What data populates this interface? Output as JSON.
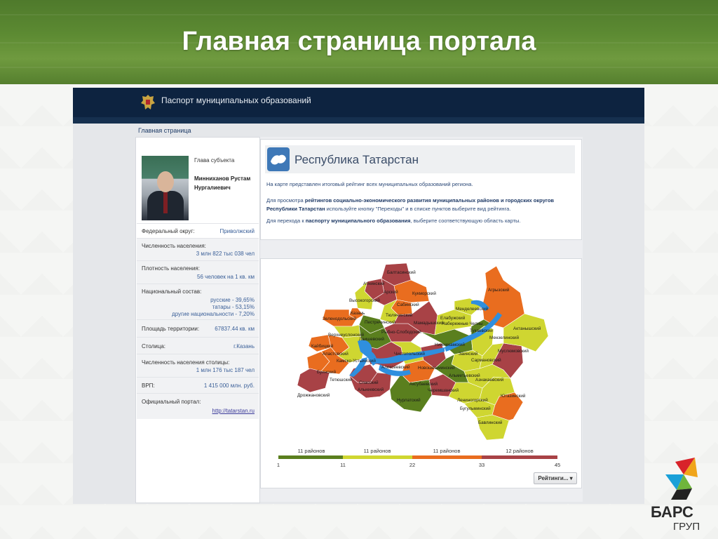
{
  "slide": {
    "title": "Главная страница портала"
  },
  "portal": {
    "name": "Паспорт муниципальных образований",
    "breadcrumb": "Главная страница"
  },
  "profile": {
    "head_label": "Глава субъекта",
    "head_name": "Минниханов Рустам Нургалиевич",
    "fields": {
      "district_label": "Федеральный округ:",
      "district_value": "Приволжский",
      "population_label": "Численность населения:",
      "population_value": "3 млн 822 тыс 038 чел",
      "density_label": "Плотность населения:",
      "density_value": "56 человек на 1 кв. км",
      "ethnic_label": "Национальный состав:",
      "ethnic_values": [
        "русские - 39,65%",
        "татары - 53,15%",
        "другие национальности - 7,20%"
      ],
      "area_label": "Площадь территории:",
      "area_value": "67837.44 кв. км",
      "capital_label": "Столица:",
      "capital_value": "г.Казань",
      "capital_pop_label": "Численность населения столицы:",
      "capital_pop_value": "1 млн 176 тыс 187 чел",
      "grp_label": "ВРП:",
      "grp_value": "1 415 000 млн. руб.",
      "portal_label": "Официальный портал:",
      "portal_value": "http://tatarstan.ru"
    }
  },
  "region": {
    "title": "Республика Татарстан",
    "p1": "На карте представлен итоговый рейтинг всех муниципальных образований региона.",
    "p2_a": "Для просмотра ",
    "p2_b": "рейтингов социально-экономического развития муниципальных районов и городских округов Республики Татарстан",
    "p2_c": " используйте кнопку \"Переходы\" и в списке пунктов выберите вид рейтинга.",
    "p3_a": "Для перехода к ",
    "p3_b": "паспорту муниципального образования",
    "p3_c": ", выберите соответствующую область карты."
  },
  "legend": {
    "groups": [
      "11 районов",
      "11 районов",
      "11 районов",
      "12 районов"
    ],
    "ticks": [
      "1",
      "11",
      "22",
      "33",
      "45"
    ],
    "colors": [
      "#5a7f1e",
      "#cfd631",
      "#e96d1f",
      "#a84246"
    ]
  },
  "ratings_button": "Рейтинги... ▾",
  "logo": {
    "line1": "БАРС",
    "line2": "ГРУП"
  },
  "districts": [
    {
      "name": "Балтасинский",
      "color": "#a84246"
    },
    {
      "name": "Атнинский",
      "color": "#a84246"
    },
    {
      "name": "Арский",
      "color": "#a84246"
    },
    {
      "name": "Кукморский",
      "color": "#e96d1f"
    },
    {
      "name": "Сабинский",
      "color": "#e96d1f"
    },
    {
      "name": "Высокогорский",
      "color": "#cfd631"
    },
    {
      "name": "Казань",
      "color": "#e96d1f"
    },
    {
      "name": "Тюлячинский",
      "color": "#cfd631"
    },
    {
      "name": "Зеленодольский",
      "color": "#e96d1f"
    },
    {
      "name": "Пестречинский",
      "color": "#5a7f1e"
    },
    {
      "name": "Рыбно-Слободский",
      "color": "#a84246"
    },
    {
      "name": "Мамадышский",
      "color": "#a84246"
    },
    {
      "name": "Верхнеуслонский",
      "color": "#cfd631"
    },
    {
      "name": "Лаишевский",
      "color": "#5a7f1e"
    },
    {
      "name": "Кайбицкий",
      "color": "#e96d1f"
    },
    {
      "name": "Апастовский",
      "color": "#e96d1f"
    },
    {
      "name": "Камско-Устьинский",
      "color": "#cfd631"
    },
    {
      "name": "Буинский",
      "color": "#e96d1f"
    },
    {
      "name": "Тетюшский",
      "color": "#e96d1f"
    },
    {
      "name": "Дрожжановский",
      "color": "#a84246"
    },
    {
      "name": "Спасский",
      "color": "#a84246"
    },
    {
      "name": "Алексеевский",
      "color": "#a84246"
    },
    {
      "name": "Алькеевский",
      "color": "#a84246"
    },
    {
      "name": "Чистопольский",
      "color": "#cfd631"
    },
    {
      "name": "Новошешминский",
      "color": "#a84246"
    },
    {
      "name": "Аксубаевский",
      "color": "#e96d1f"
    },
    {
      "name": "Нурлатский",
      "color": "#5a7f1e"
    },
    {
      "name": "Черемшанский",
      "color": "#a84246"
    },
    {
      "name": "Нижнекамский",
      "color": "#5a7f1e"
    },
    {
      "name": "Заинский",
      "color": "#cfd631"
    },
    {
      "name": "Альметьевский",
      "color": "#5a7f1e"
    },
    {
      "name": "Лениногорский",
      "color": "#cfd631"
    },
    {
      "name": "Бугульминский",
      "color": "#cfd631"
    },
    {
      "name": "Бавлинский",
      "color": "#cfd631"
    },
    {
      "name": "Азнакаевский",
      "color": "#cfd631"
    },
    {
      "name": "Ютазинский",
      "color": "#e96d1f"
    },
    {
      "name": "Сармановский",
      "color": "#cfd631"
    },
    {
      "name": "Муслюмовский",
      "color": "#a84246"
    },
    {
      "name": "Мензелинский",
      "color": "#cfd631"
    },
    {
      "name": "Актанышский",
      "color": "#cfd631"
    },
    {
      "name": "Тукаевский",
      "color": "#cfd631"
    },
    {
      "name": "Набережные Челны",
      "color": "#5a7f1e"
    },
    {
      "name": "Елабужский",
      "color": "#cfd631"
    },
    {
      "name": "Менделеевский",
      "color": "#cfd631"
    },
    {
      "name": "Агрызский",
      "color": "#e96d1f"
    }
  ]
}
